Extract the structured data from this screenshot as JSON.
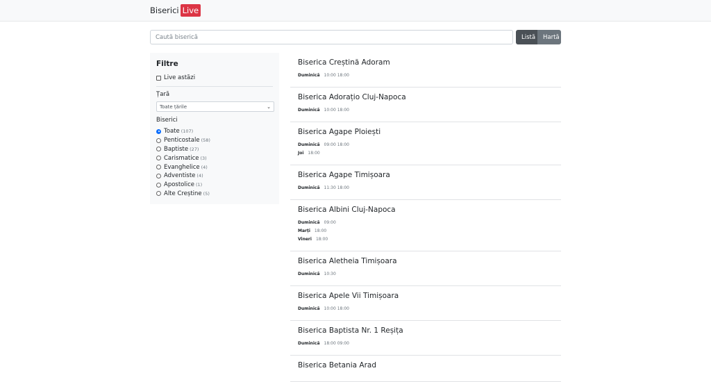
{
  "navbar": {
    "brand": "Biserici",
    "badge": "Live"
  },
  "search": {
    "placeholder": "Caută biserică"
  },
  "view_toggle": {
    "list": "Listă",
    "map": "Hartă"
  },
  "filters": {
    "title": "Filtre",
    "live_today": "Live astăzi",
    "country_label": "Țară",
    "country_selected": "Toate țările",
    "churches_label": "Biserici",
    "options": [
      {
        "label": "Toate",
        "count": "(107)"
      },
      {
        "label": "Penticostale",
        "count": "(58)"
      },
      {
        "label": "Baptiste",
        "count": "(27)"
      },
      {
        "label": "Carismatice",
        "count": "(3)"
      },
      {
        "label": "Evanghelice",
        "count": "(4)"
      },
      {
        "label": "Adventiste",
        "count": "(4)"
      },
      {
        "label": "Apostolice",
        "count": "(1)"
      },
      {
        "label": "Alte Creștine",
        "count": "(5)"
      }
    ]
  },
  "churches": [
    {
      "name": "Biserica Creștină Adoram",
      "schedule": [
        {
          "day": "Duminică",
          "times": "10:00 18:00"
        }
      ]
    },
    {
      "name": "Biserica Adorațio Cluj-Napoca",
      "schedule": [
        {
          "day": "Duminică",
          "times": "10:00 18:00"
        }
      ]
    },
    {
      "name": "Biserica Agape Ploiești",
      "schedule": [
        {
          "day": "Duminică",
          "times": "09:00 18:00"
        },
        {
          "day": "Joi",
          "times": "18:00"
        }
      ]
    },
    {
      "name": "Biserica Agape Timișoara",
      "schedule": [
        {
          "day": "Duminică",
          "times": "11:30 18:00"
        }
      ]
    },
    {
      "name": "Biserica Albini Cluj-Napoca",
      "schedule": [
        {
          "day": "Duminică",
          "times": "09:00"
        },
        {
          "day": "Marți",
          "times": "18:00"
        },
        {
          "day": "Vineri",
          "times": "18:00"
        }
      ]
    },
    {
      "name": "Biserica Aletheia Timișoara",
      "schedule": [
        {
          "day": "Duminică",
          "times": "10:30"
        }
      ]
    },
    {
      "name": "Biserica Apele Vii Timișoara",
      "schedule": [
        {
          "day": "Duminică",
          "times": "10:00 18:00"
        }
      ]
    },
    {
      "name": "Biserica Baptista Nr. 1 Reșița",
      "schedule": [
        {
          "day": "Duminică",
          "times": "18:00 09:00"
        }
      ]
    },
    {
      "name": "Biserica Betania Arad",
      "schedule": []
    }
  ]
}
